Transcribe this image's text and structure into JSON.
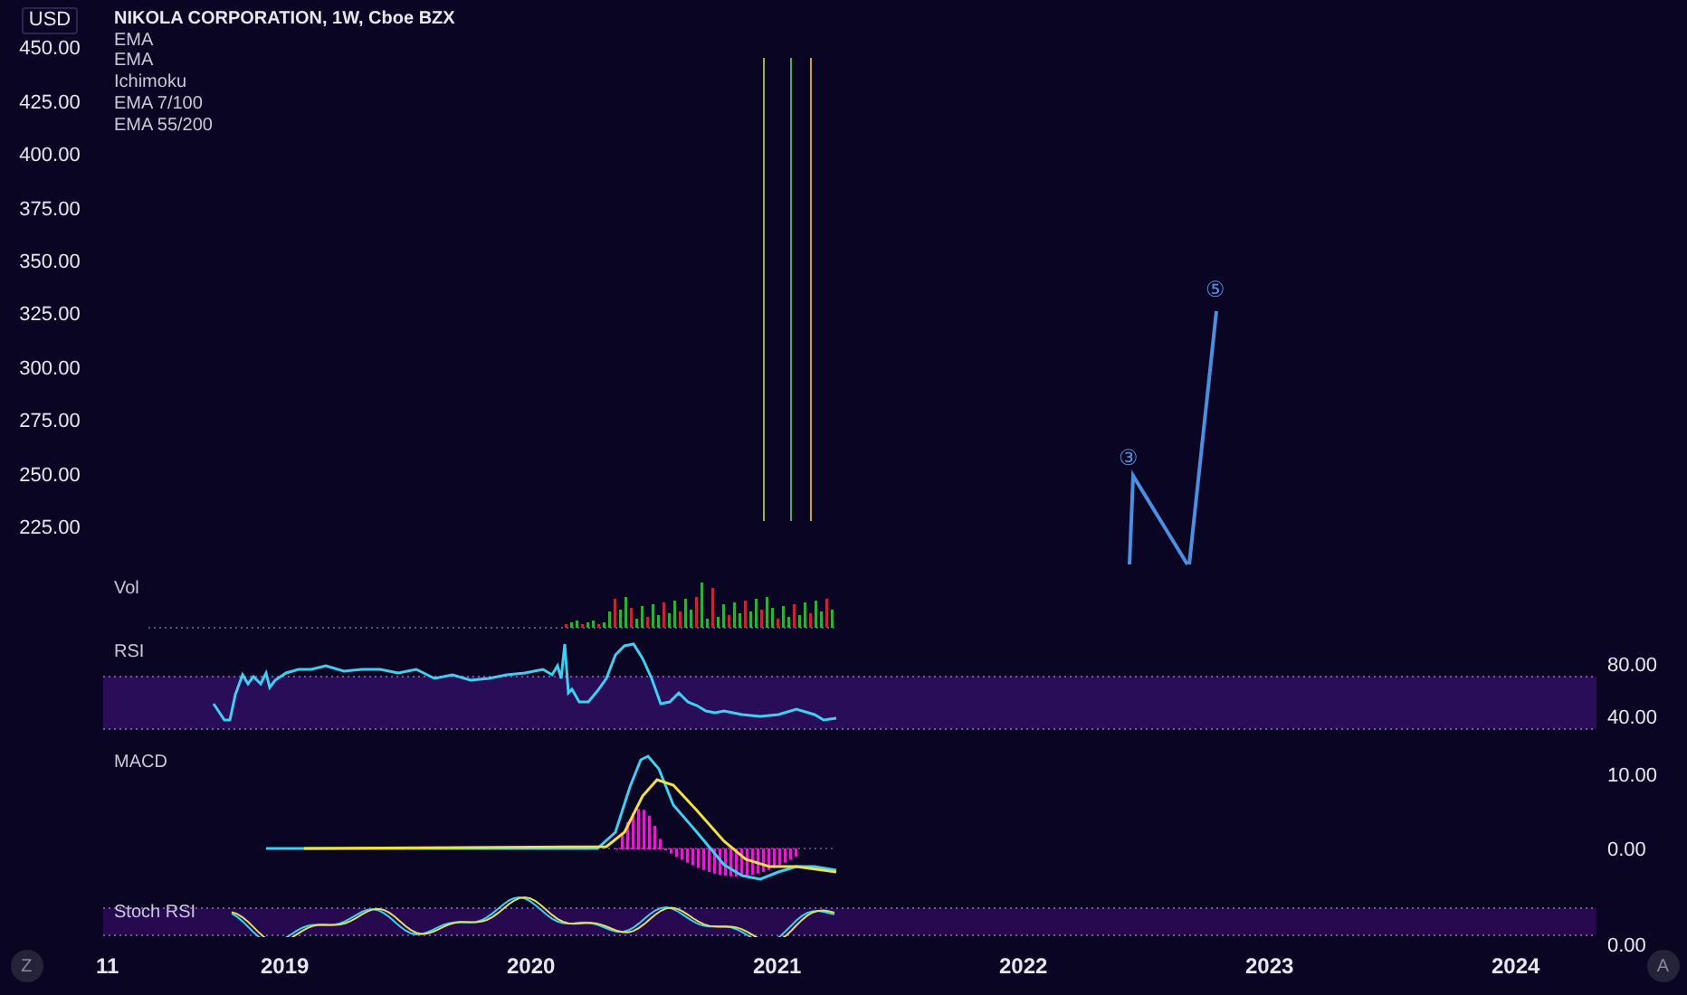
{
  "legend": {
    "title": "NIKOLA CORPORATION, 1W, Cboe BZX",
    "indicators": [
      "EMA",
      "EMA",
      "Ichimoku",
      "EMA 7/100",
      "EMA 55/200"
    ]
  },
  "price_axis": {
    "currency": "USD",
    "labels": [
      "450.00",
      "425.00",
      "400.00",
      "375.00",
      "350.00",
      "325.00",
      "300.00",
      "275.00",
      "250.00",
      "225.00"
    ]
  },
  "wave_labels": [
    "③",
    "⑤"
  ],
  "panes": [
    {
      "kind": "volume",
      "label": "Vol"
    },
    {
      "kind": "rsi",
      "label": "RSI"
    },
    {
      "kind": "macd",
      "label": "MACD"
    },
    {
      "kind": "stoch",
      "label": "Stoch RSI"
    }
  ],
  "indicator_axis": [
    "80.00",
    "40.00",
    "10.00",
    "0.00",
    "0.00"
  ],
  "time_axis": [
    "11",
    "2019",
    "2020",
    "2021",
    "2022",
    "2023",
    "2024"
  ],
  "buttons": [
    "Z",
    "A"
  ]
}
